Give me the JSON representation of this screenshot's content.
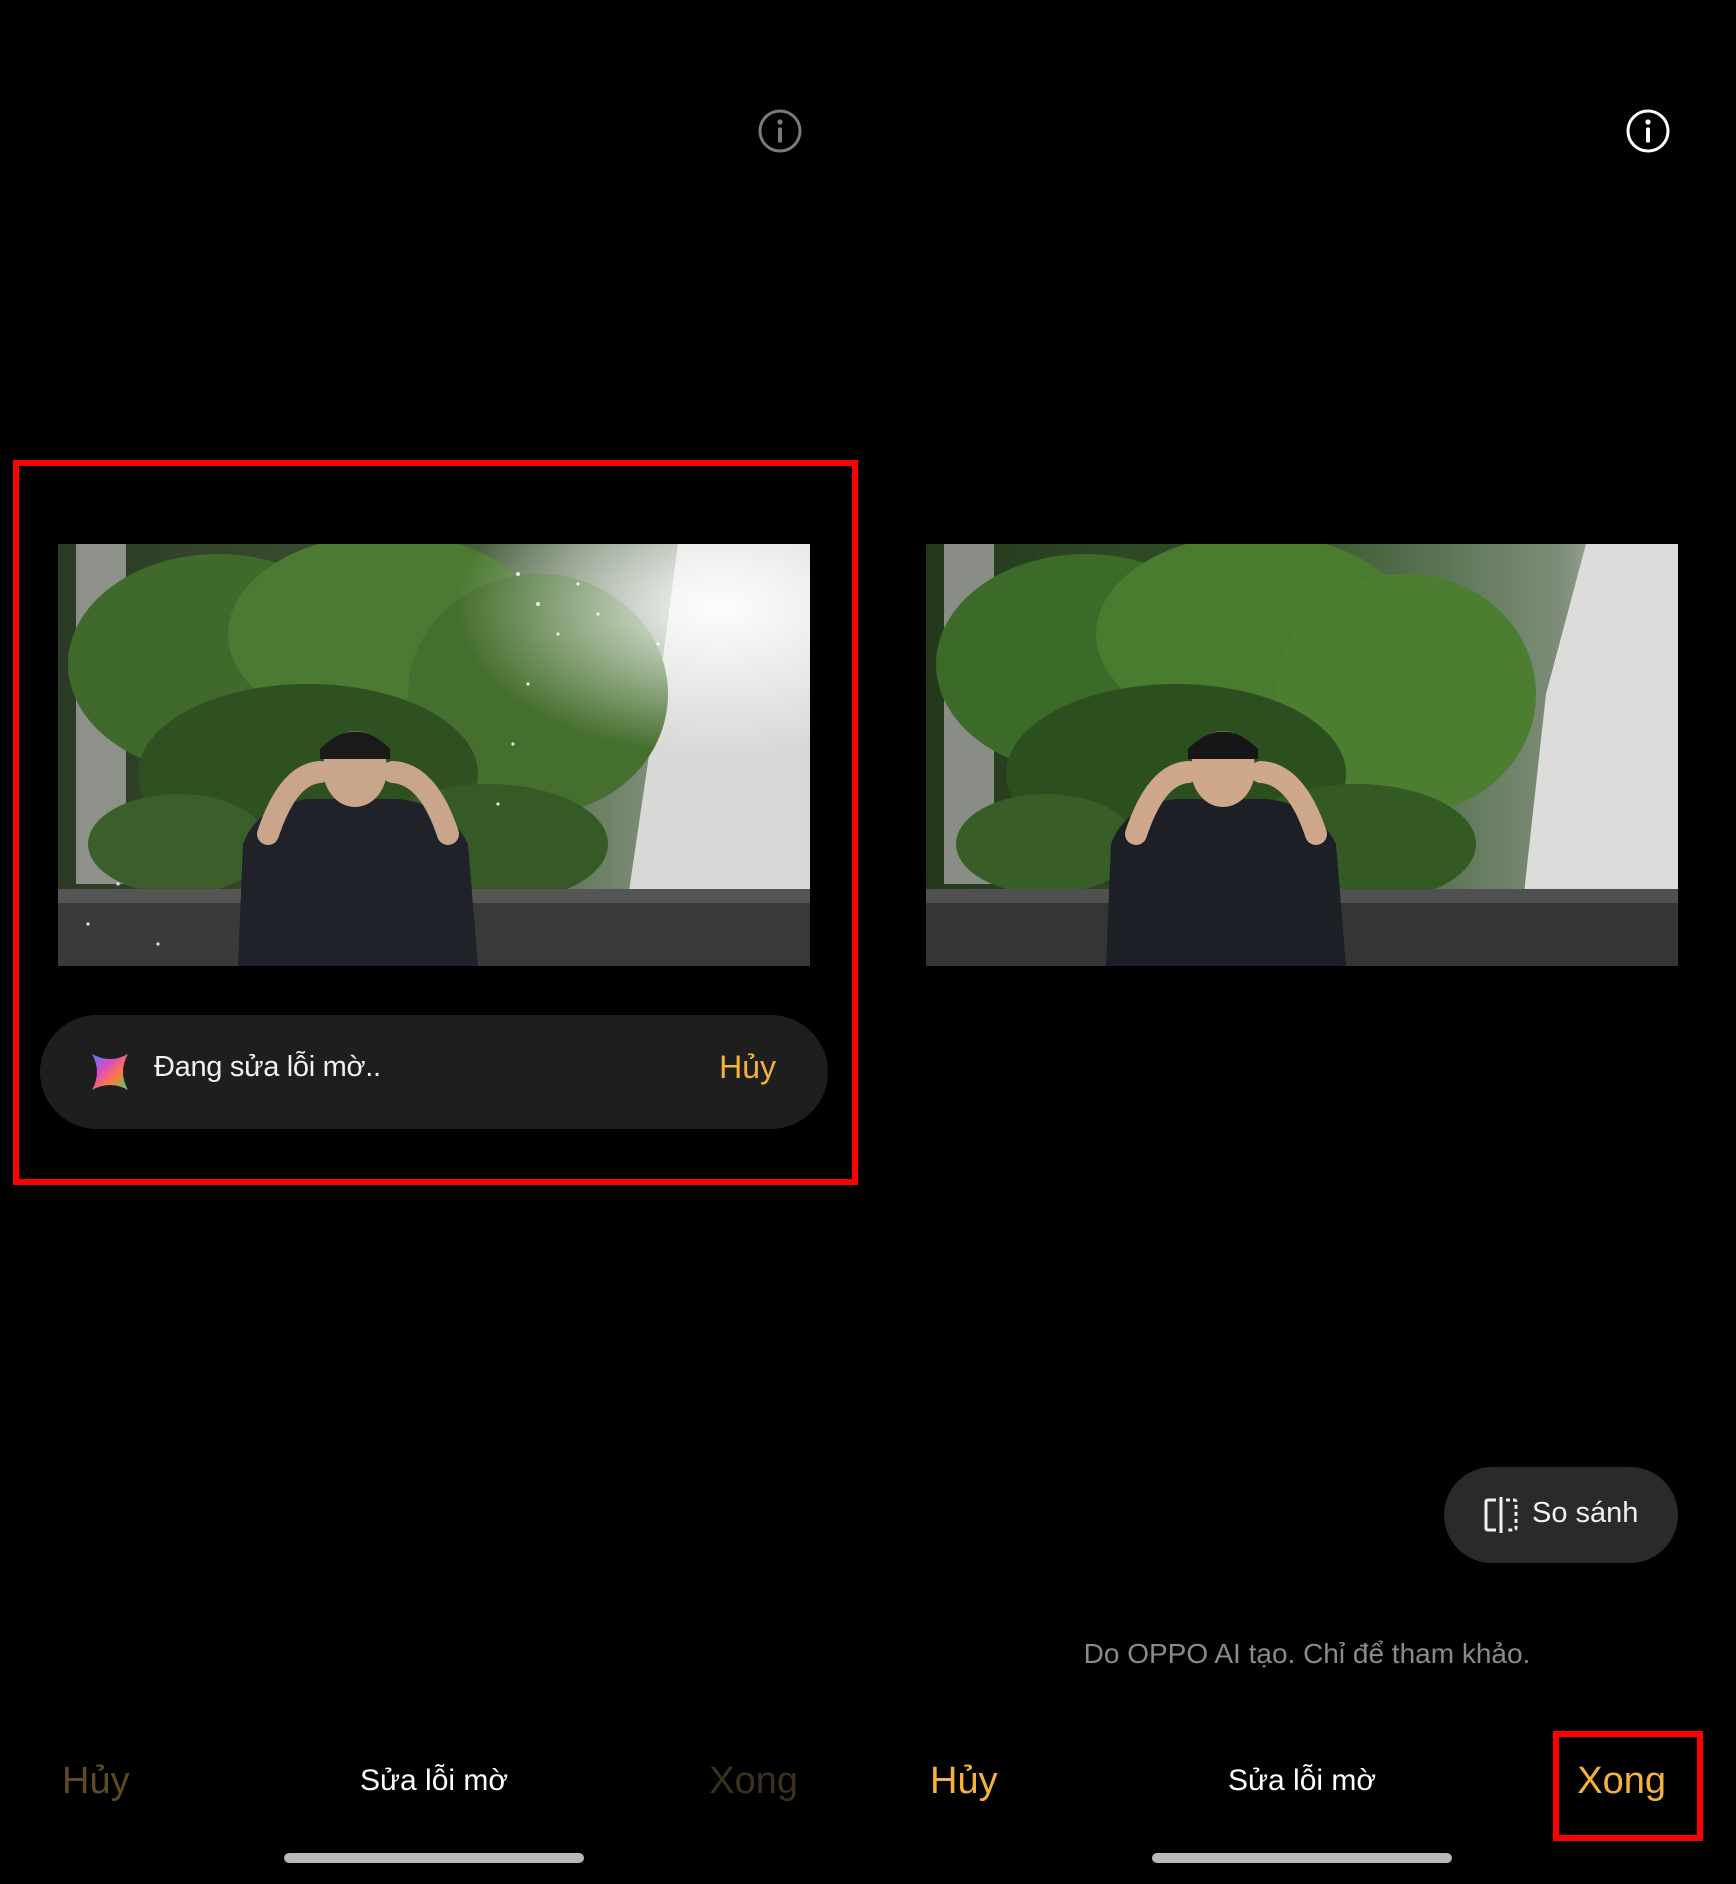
{
  "left_screen": {
    "progress": {
      "text": "Đang sửa lỗi mờ..",
      "cancel_label": "Hủy"
    },
    "bottom_bar": {
      "cancel_label": "Hủy",
      "title": "Sửa lỗi mờ",
      "done_label": "Xong",
      "done_enabled": false
    }
  },
  "right_screen": {
    "compare_label": "So sánh",
    "disclaimer": "Do OPPO AI tạo. Chỉ để tham khảo.",
    "bottom_bar": {
      "cancel_label": "Hủy",
      "title": "Sửa lỗi mờ",
      "done_label": "Xong",
      "done_enabled": true
    }
  },
  "colors": {
    "accent": "#f4b23d",
    "highlight": "#ff0000",
    "pill_background": "#1e1e1e"
  },
  "icons": {
    "info": "info-icon",
    "ai": "ai-sparkle-icon",
    "compare": "compare-icon"
  }
}
